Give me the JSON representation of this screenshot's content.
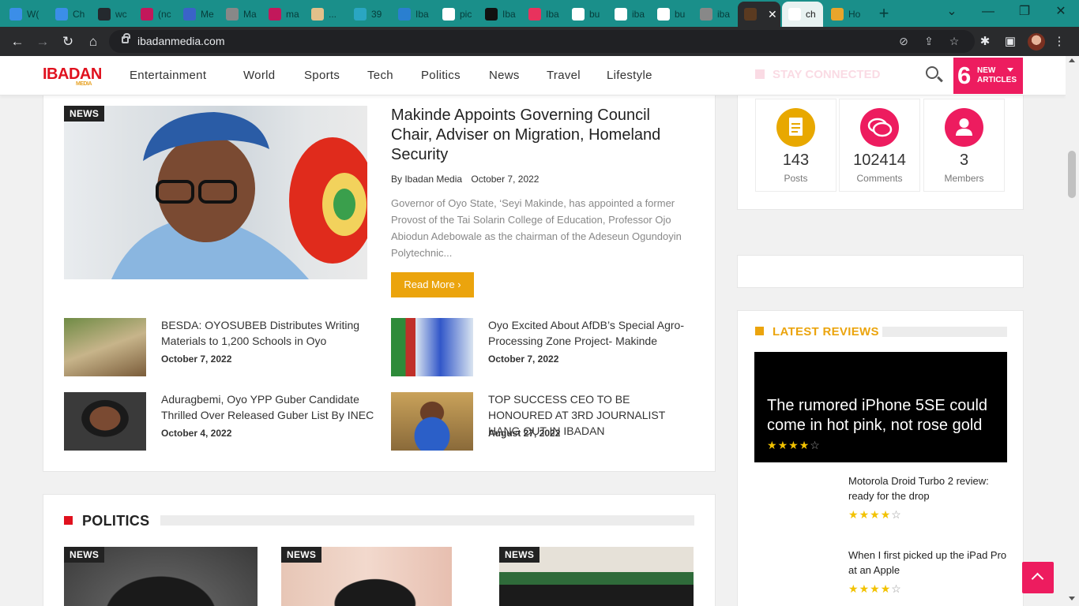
{
  "browser": {
    "tabs": [
      {
        "title": "W(",
        "color": "#3b8ee8"
      },
      {
        "title": "Ch",
        "color": "#3b8ee8"
      },
      {
        "title": "wc",
        "color": "#24292e"
      },
      {
        "title": "(nc",
        "color": "#c2185b"
      },
      {
        "title": "Me",
        "color": "#3a63c8"
      },
      {
        "title": "Ma",
        "color": "#888888"
      },
      {
        "title": "ma",
        "color": "#c2185b"
      },
      {
        "title": "...",
        "color": "#e3c08a"
      },
      {
        "title": "39",
        "color": "#2aa6c2"
      },
      {
        "title": "Iba",
        "color": "#2a7fd0"
      },
      {
        "title": "pic",
        "color": "#ffffff"
      },
      {
        "title": "Iba",
        "color": "#111111"
      },
      {
        "title": "Iba",
        "color": "#e8325d"
      },
      {
        "title": "bu",
        "color": "#ffffff"
      },
      {
        "title": "iba",
        "color": "#ffffff"
      },
      {
        "title": "bu",
        "color": "#ffffff"
      },
      {
        "title": "iba",
        "color": "#888888"
      },
      {
        "title": "",
        "color": "#5a3a20"
      },
      {
        "title": "ch",
        "color": "#ffffff"
      },
      {
        "title": "Ho",
        "color": "#e8a52b"
      }
    ],
    "url": "ibadanmedia.com"
  },
  "site": {
    "logo": "IBADAN",
    "logo_sub": "MEDIA",
    "nav": [
      "Entertainment",
      "World",
      "Sports",
      "Tech",
      "Politics",
      "News",
      "Travel",
      "Lifestyle"
    ],
    "new_articles": {
      "count": "6",
      "line1": "NEW",
      "line2": "ARTICLES"
    },
    "stay_connected": "STAY CONNECTED"
  },
  "featured": {
    "badge": "NEWS",
    "title": "Makinde Appoints Governing Council Chair, Adviser on Migration, Homeland Security",
    "author": "By Ibadan Media",
    "date": "October 7, 2022",
    "excerpt": "Governor of Oyo State, ‘Seyi Makinde, has appointed a former Provost of the Tai Solarin College of Education, Professor Ojo Abiodun Adebowale as the chairman of the Adeseun Ogundoyin Polytechnic...",
    "read_more": "Read More"
  },
  "list_items": [
    {
      "title": "BESDA: OYOSUBEB Distributes Writing Materials to 1,200 Schools in Oyo",
      "date": "October 7, 2022"
    },
    {
      "title": "Oyo Excited About AfDB’s Special Agro-Processing Zone Project- Makinde",
      "date": "October 7, 2022"
    },
    {
      "title": "Aduragbemi, Oyo YPP Guber Candidate Thrilled Over Released Guber List By INEC",
      "date": "October 4, 2022"
    },
    {
      "title": "TOP SUCCESS CEO TO BE HONOURED AT 3RD JOURNALIST HANG OUT IN IBADAN",
      "date": "August 27, 2022"
    }
  ],
  "politics": {
    "heading": "POLITICS",
    "badges": [
      "NEWS",
      "NEWS",
      "NEWS"
    ]
  },
  "stats": [
    {
      "value": "143",
      "label": "Posts",
      "icon": "document-icon",
      "color": "#e8a800"
    },
    {
      "value": "102414",
      "label": "Comments",
      "icon": "comments-icon",
      "color": "#ed1c5f"
    },
    {
      "value": "3",
      "label": "Members",
      "icon": "user-icon",
      "color": "#ed1c5f"
    }
  ],
  "reviews": {
    "heading": "LATEST REVIEWS",
    "hero": {
      "title": "The rumored iPhone 5SE could come in hot pink, not rose gold",
      "rating": 4
    },
    "items": [
      {
        "title": "Motorola Droid Turbo 2 review: ready for the drop",
        "rating": 4
      },
      {
        "title": "When I first picked up the iPad Pro at an Apple",
        "rating": 4
      }
    ]
  },
  "colors": {
    "accent_pink": "#ed1c5f",
    "accent_gold": "#eba40d",
    "brand_red": "#e0111e"
  }
}
